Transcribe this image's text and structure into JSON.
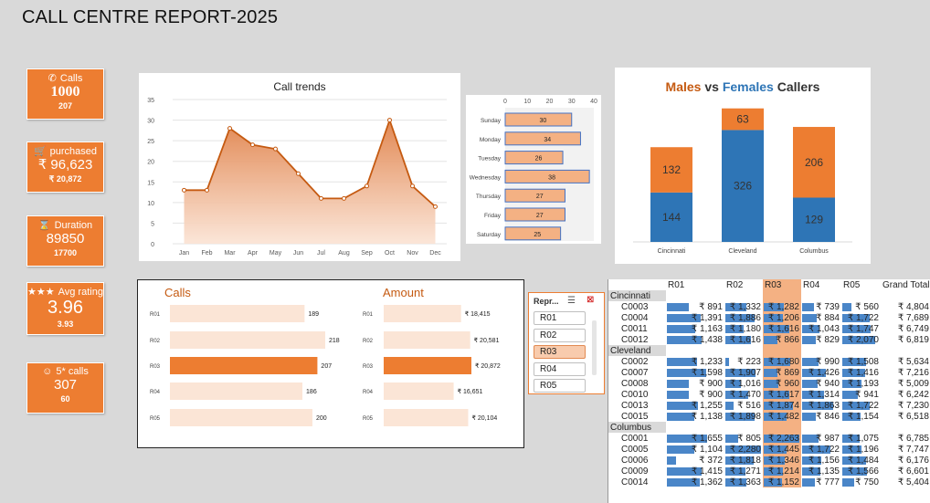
{
  "report_title": "CALL CENTRE REPORT-2025",
  "kpis": [
    {
      "label": "Calls",
      "icon": "phone-icon",
      "glyph": "✆",
      "value": "1000",
      "sub": "207"
    },
    {
      "label": "purchased",
      "icon": "cart-icon",
      "glyph": "🛒",
      "value": "₹ 96,623",
      "sub": "₹ 20,872"
    },
    {
      "label": "Duration",
      "icon": "hourglass-icon",
      "glyph": "⌛",
      "value": "89850",
      "sub": "17700"
    },
    {
      "label": "Avg rating",
      "icon": "stars-icon",
      "glyph": "★★★",
      "value": "3.96",
      "sub": "3.93"
    },
    {
      "label": "5* calls",
      "icon": "smiley-icon",
      "glyph": "☺",
      "value": "307",
      "sub": "60"
    }
  ],
  "colors": {
    "accent": "#ed7d31",
    "light": "#f8cbad",
    "blue": "#2e75b6",
    "databar": "#4a86c8"
  },
  "chart_data": [
    {
      "type": "area",
      "title": "Call trends",
      "categories": [
        "Jan",
        "Feb",
        "Mar",
        "Apr",
        "May",
        "Jun",
        "Jul",
        "Aug",
        "Sep",
        "Oct",
        "Nov",
        "Dec"
      ],
      "values": [
        13,
        13,
        28,
        24,
        23,
        17,
        11,
        11,
        14,
        30,
        14,
        9
      ],
      "ylim": [
        0,
        35
      ],
      "yticks": [
        0,
        5,
        10,
        15,
        20,
        25,
        30,
        35
      ]
    },
    {
      "type": "bar",
      "orientation": "horizontal",
      "categories": [
        "Sunday",
        "Monday",
        "Tuesday",
        "Wednesday",
        "Thursday",
        "Friday",
        "Saturday"
      ],
      "values": [
        30,
        34,
        26,
        38,
        27,
        27,
        25
      ],
      "xlim": [
        0,
        40
      ],
      "xticks": [
        0,
        10,
        20,
        30,
        40
      ]
    },
    {
      "type": "bar",
      "stacked": true,
      "title_parts": {
        "males": "Males",
        "vs": " vs ",
        "females": "Females",
        "callers": " Callers"
      },
      "categories": [
        "Cincinnati",
        "Cleveland",
        "Columbus"
      ],
      "series": [
        {
          "values": [
            144,
            326,
            129
          ],
          "color": "#2e75b6"
        },
        {
          "values": [
            132,
            63,
            206
          ],
          "color": "#ed7d31"
        }
      ]
    },
    {
      "type": "bar",
      "orientation": "horizontal",
      "title": "Calls",
      "categories": [
        "R01",
        "R02",
        "R03",
        "R04",
        "R05"
      ],
      "values": [
        189,
        218,
        207,
        186,
        200
      ],
      "labels": [
        "189",
        "218",
        "207",
        "186",
        "200"
      ],
      "highlight": "R03"
    },
    {
      "type": "bar",
      "orientation": "horizontal",
      "title": "Amount",
      "categories": [
        "R01",
        "R02",
        "R03",
        "R04",
        "R05"
      ],
      "values": [
        18415,
        20581,
        20872,
        16651,
        20104
      ],
      "labels": [
        "₹ 18,415",
        "₹ 20,581",
        "₹ 20,872",
        "₹ 16,651",
        "₹ 20,104"
      ],
      "highlight": "R03"
    }
  ],
  "slicer": {
    "header": "Repr...",
    "items": [
      "R01",
      "R02",
      "R03",
      "R04",
      "R05"
    ],
    "selected": "R03"
  },
  "pivot": {
    "columns": [
      "",
      "R01",
      "R02",
      "R03",
      "R04",
      "R05",
      "Grand Total"
    ],
    "groups": [
      {
        "name": "Cincinnati",
        "rows": [
          {
            "code": "C0003",
            "vals": [
              "₹ 891",
              "₹ 1,332",
              "₹ 1,282",
              "₹ 739",
              "₹ 560"
            ],
            "raw": [
              891,
              1332,
              1282,
              739,
              560
            ],
            "total": "₹ 4,804"
          },
          {
            "code": "C0004",
            "vals": [
              "₹ 1,391",
              "₹ 1,886",
              "₹ 1,206",
              "₹ 884",
              "₹ 1,722"
            ],
            "raw": [
              1391,
              1886,
              1206,
              884,
              1722
            ],
            "total": "₹ 7,689"
          },
          {
            "code": "C0011",
            "vals": [
              "₹ 1,163",
              "₹ 1,180",
              "₹ 1,616",
              "₹ 1,043",
              "₹ 1,747"
            ],
            "raw": [
              1163,
              1180,
              1616,
              1043,
              1747
            ],
            "total": "₹ 6,749"
          },
          {
            "code": "C0012",
            "vals": [
              "₹ 1,438",
              "₹ 1,616",
              "₹ 866",
              "₹ 829",
              "₹ 2,070"
            ],
            "raw": [
              1438,
              1616,
              866,
              829,
              2070
            ],
            "total": "₹ 6,819"
          }
        ]
      },
      {
        "name": "Cleveland",
        "rows": [
          {
            "code": "C0002",
            "vals": [
              "₹ 1,233",
              "₹ 223",
              "₹ 1,680",
              "₹ 990",
              "₹ 1,508"
            ],
            "raw": [
              1233,
              223,
              1680,
              990,
              1508
            ],
            "total": "₹ 5,634"
          },
          {
            "code": "C0007",
            "vals": [
              "₹ 1,598",
              "₹ 1,907",
              "₹ 869",
              "₹ 1,426",
              "₹ 1,416"
            ],
            "raw": [
              1598,
              1907,
              869,
              1426,
              1416
            ],
            "total": "₹ 7,216"
          },
          {
            "code": "C0008",
            "vals": [
              "₹ 900",
              "₹ 1,016",
              "₹ 960",
              "₹ 940",
              "₹ 1,193"
            ],
            "raw": [
              900,
              1016,
              960,
              940,
              1193
            ],
            "total": "₹ 5,009"
          },
          {
            "code": "C0010",
            "vals": [
              "₹ 900",
              "₹ 1,470",
              "₹ 1,617",
              "₹ 1,314",
              "₹ 941"
            ],
            "raw": [
              900,
              1470,
              1617,
              1314,
              941
            ],
            "total": "₹ 6,242"
          },
          {
            "code": "C0013",
            "vals": [
              "₹ 1,255",
              "₹ 516",
              "₹ 1,874",
              "₹ 1,863",
              "₹ 1,722"
            ],
            "raw": [
              1255,
              516,
              1874,
              1863,
              1722
            ],
            "total": "₹ 7,230"
          },
          {
            "code": "C0015",
            "vals": [
              "₹ 1,138",
              "₹ 1,898",
              "₹ 1,482",
              "₹ 846",
              "₹ 1,154"
            ],
            "raw": [
              1138,
              1898,
              1482,
              846,
              1154
            ],
            "total": "₹ 6,518"
          }
        ]
      },
      {
        "name": "Columbus",
        "rows": [
          {
            "code": "C0001",
            "vals": [
              "₹ 1,655",
              "₹ 805",
              "₹ 2,263",
              "₹ 987",
              "₹ 1,075"
            ],
            "raw": [
              1655,
              805,
              2263,
              987,
              1075
            ],
            "total": "₹ 6,785"
          },
          {
            "code": "C0005",
            "vals": [
              "₹ 1,104",
              "₹ 2,280",
              "₹ 1,445",
              "₹ 1,722",
              "₹ 1,196"
            ],
            "raw": [
              1104,
              2280,
              1445,
              1722,
              1196
            ],
            "total": "₹ 7,747"
          },
          {
            "code": "C0006",
            "vals": [
              "₹ 372",
              "₹ 1,818",
              "₹ 1,346",
              "₹ 1,156",
              "₹ 1,484"
            ],
            "raw": [
              372,
              1818,
              1346,
              1156,
              1484
            ],
            "total": "₹ 6,176"
          },
          {
            "code": "C0009",
            "vals": [
              "₹ 1,415",
              "₹ 1,271",
              "₹ 1,214",
              "₹ 1,135",
              "₹ 1,566"
            ],
            "raw": [
              1415,
              1271,
              1214,
              1135,
              1566
            ],
            "total": "₹ 6,601"
          },
          {
            "code": "C0014",
            "vals": [
              "₹ 1,362",
              "₹ 1,363",
              "₹ 1,152",
              "₹ 777",
              "₹ 750"
            ],
            "raw": [
              1362,
              1363,
              1152,
              777,
              750
            ],
            "total": "₹ 5,404"
          }
        ]
      }
    ]
  }
}
